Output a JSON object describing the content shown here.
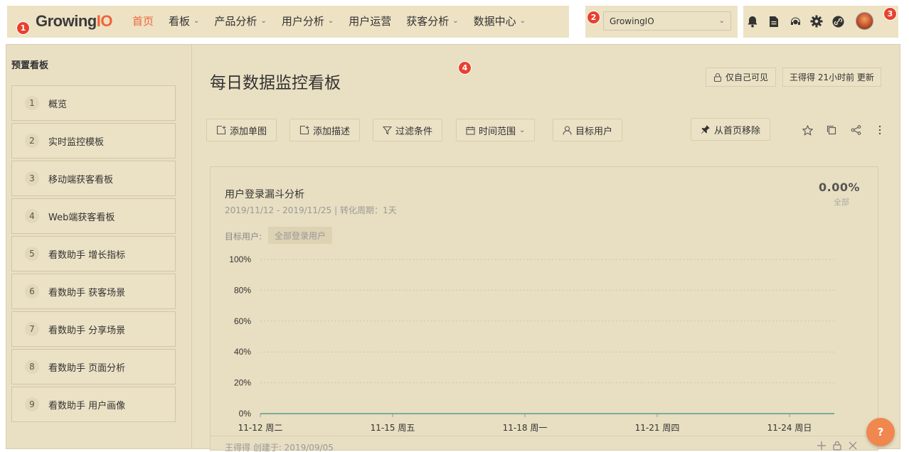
{
  "badges": {
    "b1": "1",
    "b2": "2",
    "b3": "3",
    "b4": "4"
  },
  "logo": {
    "text_a": "Growing",
    "text_b": "IO"
  },
  "nav": {
    "items": [
      {
        "label": "首页",
        "active": true,
        "dropdown": false
      },
      {
        "label": "看板",
        "active": false,
        "dropdown": true
      },
      {
        "label": "产品分析",
        "active": false,
        "dropdown": true
      },
      {
        "label": "用户分析",
        "active": false,
        "dropdown": true
      },
      {
        "label": "用户运营",
        "active": false,
        "dropdown": false
      },
      {
        "label": "获客分析",
        "active": false,
        "dropdown": true
      },
      {
        "label": "数据中心",
        "active": false,
        "dropdown": true
      }
    ]
  },
  "project_select": {
    "value": "GrowingIO"
  },
  "top_icons": [
    "bell-icon",
    "document-icon",
    "headset-icon",
    "gear-icon",
    "link-icon"
  ],
  "sidebar": {
    "title": "预置看板",
    "items": [
      {
        "num": "1",
        "label": "概览"
      },
      {
        "num": "2",
        "label": "实时监控模板"
      },
      {
        "num": "3",
        "label": "移动端获客看板"
      },
      {
        "num": "4",
        "label": "Web端获客看板"
      },
      {
        "num": "5",
        "label": "看数助手 增长指标"
      },
      {
        "num": "6",
        "label": "看数助手 获客场景"
      },
      {
        "num": "7",
        "label": "看数助手 分享场景"
      },
      {
        "num": "8",
        "label": "看数助手 页面分析"
      },
      {
        "num": "9",
        "label": "看数助手 用户画像"
      }
    ]
  },
  "header": {
    "title": "每日数据监控看板",
    "visibility": "仅自己可见",
    "updated": "王得得 21小时前 更新"
  },
  "toolbar": {
    "add_chart": "添加单图",
    "add_desc": "添加描述",
    "filter": "过滤条件",
    "time_range": "时间范围",
    "target_user": "目标用户",
    "remove_home": "从首页移除"
  },
  "card": {
    "title": "用户登录漏斗分析",
    "subtitle": "2019/11/12 - 2019/11/25 | 转化周期：1天",
    "percent": "0.00%",
    "percent_label": "全部",
    "target_label": "目标用户:",
    "target_value": "全部登录用户",
    "creator": "王得得 创建于: 2019/09/05"
  },
  "chart_data": {
    "type": "line",
    "x": [
      "11-12 周二",
      "11-15 周五",
      "11-18 周一",
      "11-21 周四",
      "11-24 周日"
    ],
    "y_ticks": [
      "100%",
      "80%",
      "60%",
      "40%",
      "20%",
      "0%"
    ],
    "ylim": [
      0,
      100
    ],
    "series": [
      {
        "values": [
          0,
          0,
          0,
          0,
          0
        ]
      }
    ],
    "grid": true,
    "line_color": "#5b9a8b"
  },
  "help": {
    "label": "?"
  }
}
